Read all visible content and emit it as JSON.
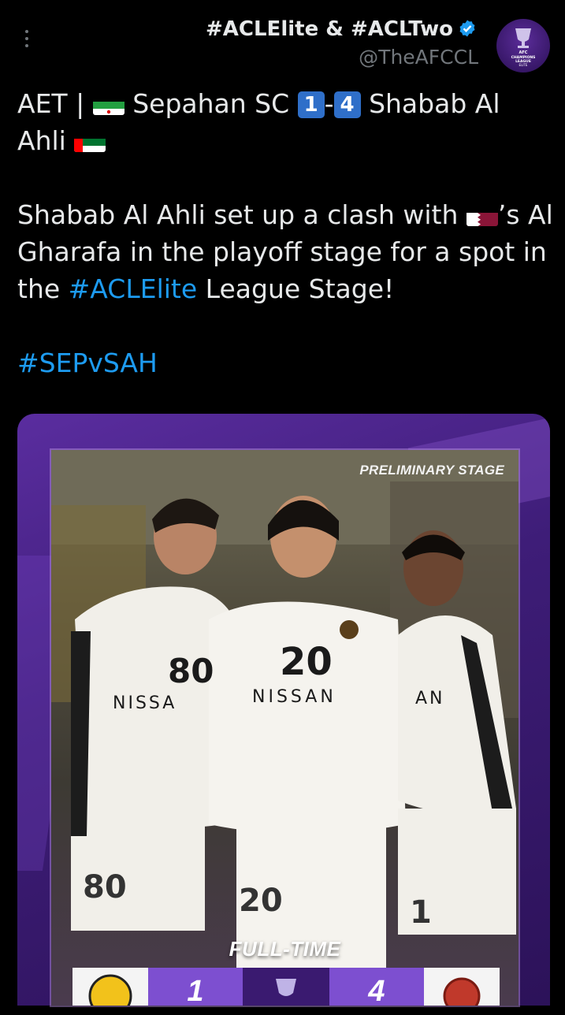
{
  "header": {
    "display_name": "#ACLElite & #ACLTwo",
    "handle": "@TheAFCCL",
    "verified_icon": "verified-badge-icon",
    "avatar_icon": "afc-champions-league-logo",
    "avatar_text": "AFC CHAMPIONS LEAGUE ELITE"
  },
  "tweet": {
    "line1_prefix": "AET | ",
    "team_home": "Sepahan SC",
    "score_home": "1",
    "score_sep": "-",
    "score_away": "4",
    "team_away_a": "Shabab Al",
    "team_away_b": "Ahli",
    "para2_a": "Shabab Al Ahli set up a clash with ",
    "para2_b": "’s Al Gharafa in the playoff stage for a spot in the ",
    "para2_link": "#ACLElite",
    "para2_c": " League Stage!",
    "hashtag": "#SEPvSAH"
  },
  "media": {
    "stage_label": "PRELIMINARY STAGE",
    "fulltime_label": "FULL-TIME",
    "score_left": "1",
    "score_right": "4",
    "players": [
      {
        "shirt_number": "80",
        "sponsor": "NISSA"
      },
      {
        "shirt_number": "20",
        "sponsor": "NISSAN"
      },
      {
        "shirt_number": "",
        "sponsor": "AN"
      }
    ],
    "shorts_numbers": [
      "80",
      "20",
      "1"
    ]
  },
  "colors": {
    "link": "#1d9bf0",
    "background": "#000000",
    "text": "#e7e9ea",
    "muted": "#71767b",
    "brand_purple": "#5a2d9f"
  }
}
